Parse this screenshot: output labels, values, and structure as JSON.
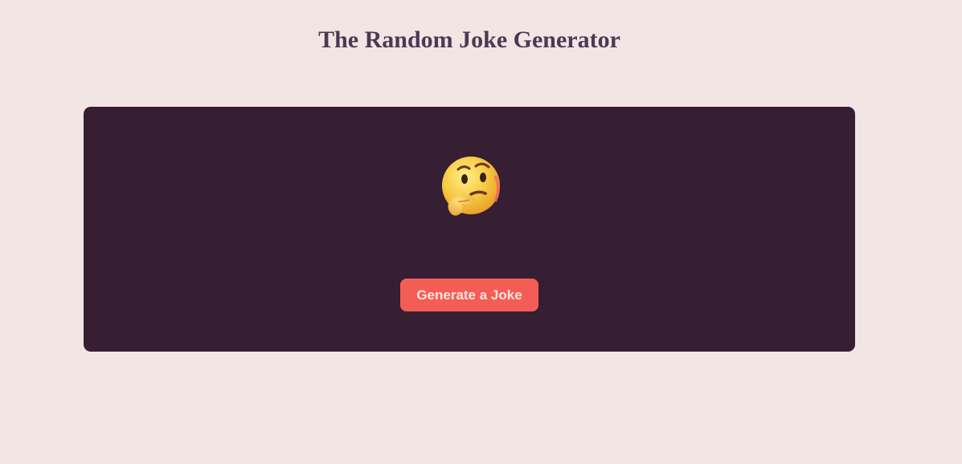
{
  "page": {
    "title": "The Random Joke Generator"
  },
  "card": {
    "emoji_icon": "thinking-face-icon",
    "button_label": "Generate a Joke"
  },
  "colors": {
    "background": "#f1e6e4",
    "title": "#4a3a52",
    "card": "#361e33",
    "button": "#f45d55",
    "button_text": "#ffe3df"
  }
}
